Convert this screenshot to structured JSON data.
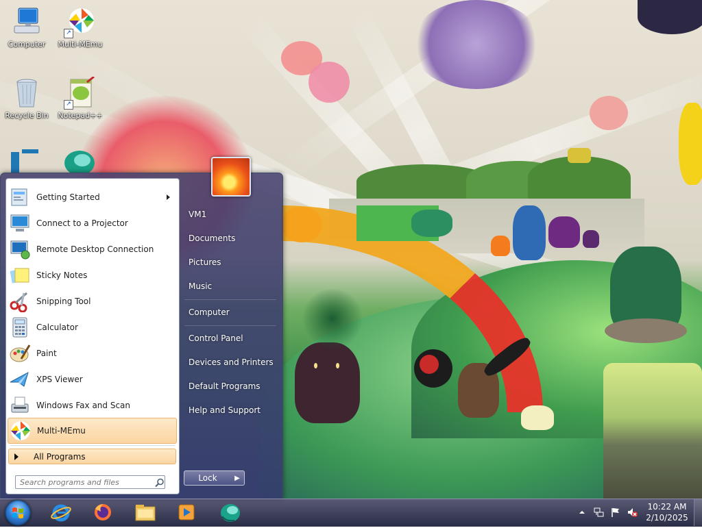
{
  "desktop": {
    "icons": [
      {
        "label": "Computer"
      },
      {
        "label": "Multi-MEmu"
      },
      {
        "label": "Recycle Bin"
      },
      {
        "label": "Notepad++"
      }
    ]
  },
  "start_menu": {
    "programs": [
      {
        "label": "Getting Started",
        "has_submenu": true,
        "icon": "getting-started-icon"
      },
      {
        "label": "Connect to a Projector",
        "icon": "projector-icon"
      },
      {
        "label": "Remote Desktop Connection",
        "icon": "remote-desktop-icon"
      },
      {
        "label": "Sticky Notes",
        "icon": "sticky-notes-icon"
      },
      {
        "label": "Snipping Tool",
        "icon": "snipping-tool-icon"
      },
      {
        "label": "Calculator",
        "icon": "calculator-icon"
      },
      {
        "label": "Paint",
        "icon": "paint-icon"
      },
      {
        "label": "XPS Viewer",
        "icon": "xps-viewer-icon"
      },
      {
        "label": "Windows Fax and Scan",
        "icon": "fax-scan-icon"
      },
      {
        "label": "Multi-MEmu",
        "icon": "multi-memu-icon",
        "highlighted": true
      }
    ],
    "all_programs_label": "All Programs",
    "search_placeholder": "Search programs and files",
    "right_items": [
      "VM1",
      "Documents",
      "Pictures",
      "Music",
      "Computer",
      "Control Panel",
      "Devices and Printers",
      "Default Programs",
      "Help and Support"
    ],
    "lock_label": "Lock",
    "lock_arrow": "▶"
  },
  "taskbar": {
    "apps": [
      "internet-explorer-icon",
      "firefox-icon",
      "file-explorer-icon",
      "media-player-icon",
      "multi-memu-icon"
    ],
    "clock": {
      "time": "10:22 AM",
      "date": "2/10/2025"
    },
    "tray": [
      "show-hidden-icons",
      "network-icon",
      "action-center-flag-icon",
      "volume-muted-icon"
    ]
  },
  "colors": {
    "highlight": "#fbd5a2",
    "menu_glass": "#46406e",
    "taskbar": "#1e223c"
  }
}
